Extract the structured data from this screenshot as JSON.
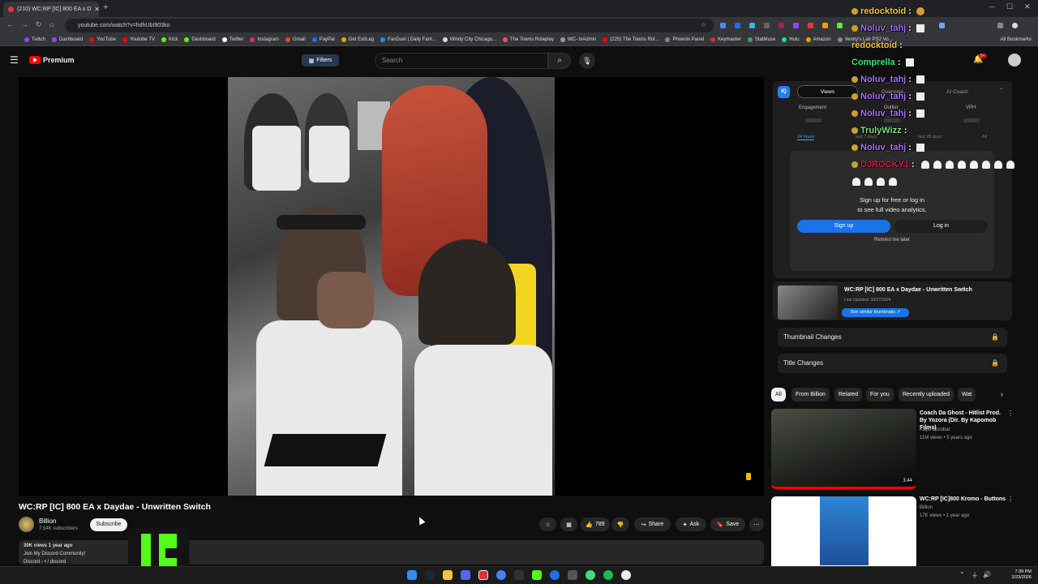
{
  "browser": {
    "tab_title": "(210) WC:RP [IC] 800 EA x D",
    "url": "youtube.com/watch?v=hdhUbI903ko",
    "bookmarks": [
      {
        "label": "Twitch",
        "color": "#9146ff"
      },
      {
        "label": "Dashboard",
        "color": "#9146ff"
      },
      {
        "label": "YouTube",
        "color": "#ff0000"
      },
      {
        "label": "Youtube TV",
        "color": "#ff0000"
      },
      {
        "label": "Kick",
        "color": "#53fc18"
      },
      {
        "label": "Dashboard",
        "color": "#53fc18"
      },
      {
        "label": "Twitter",
        "color": "#ffffff"
      },
      {
        "label": "Instagram",
        "color": "#e1306c"
      },
      {
        "label": "Gmail",
        "color": "#ea4335"
      },
      {
        "label": "PayPal",
        "color": "#1a73e8"
      },
      {
        "label": "Get ExitLag",
        "color": "#f4a000"
      },
      {
        "label": "FanDuel | Daily Fant...",
        "color": "#1493ff"
      },
      {
        "label": "Windy City Chicago...",
        "color": "#dddddd"
      },
      {
        "label": "The Towns Roleplay",
        "color": "#e55"
      },
      {
        "label": "WC- txAdmin",
        "color": "#999"
      },
      {
        "label": "(225) The Towns Rol...",
        "color": "#ff0000"
      },
      {
        "label": "Phoenix Panel",
        "color": "#888"
      },
      {
        "label": "Keymaster",
        "color": "#c33"
      },
      {
        "label": "StatMuse",
        "color": "#3a6"
      },
      {
        "label": "Hulu",
        "color": "#1ce783"
      },
      {
        "label": "Amazon",
        "color": "#ff9900"
      },
      {
        "label": "Venny's Lair PS2 Vo...",
        "color": "#888"
      }
    ],
    "all_bookmarks": "All Bookmarks"
  },
  "youtube": {
    "brand": "Premium",
    "filters": "Filters",
    "search_placeholder": "Search",
    "create": "Create",
    "notif_count": "9+"
  },
  "video": {
    "title": "WC:RP [IC] 800 EA x Daydae - Unwritten Switch",
    "channel": "Billion",
    "subscribers": "7.54K subscribers",
    "subscribe": "Subscribe",
    "likes": "789",
    "share": "Share",
    "ask": "Ask",
    "save": "Save",
    "views_date": "30K views  1 year ago",
    "desc_line1": "Join My Discord Community!",
    "desc_line2": "Discord - • / discord"
  },
  "vidiq": {
    "tabs": [
      "Views",
      "Overview",
      "AI Coach"
    ],
    "stats": [
      "Engagement",
      "Outlier",
      "VPH"
    ],
    "periods": [
      "24 hours",
      "last 7 days",
      "last 28 days",
      "All"
    ],
    "signup_line1": "Sign up for free or log in",
    "signup_line2": "to see full video analytics.",
    "signup_btn": "Sign up",
    "login_btn": "Log in",
    "remind": "Remind me later",
    "video_title": "WC:RP [IC] 800 EA x Daydae - Unwritten Switch",
    "last_updated": "Last Updated: 10/27/2024",
    "similar": "See similar thumbnails ↗",
    "thumbnail_changes": "Thumbnail Changes",
    "title_changes": "Title Changes"
  },
  "chips": [
    "All",
    "From Billion",
    "Related",
    "For you",
    "Recently uploaded",
    "Wat"
  ],
  "recommendations": [
    {
      "title": "Coach Da Ghost - Hitlist Prod. By Yozora (Dir. By Kapomob Films)",
      "channel": "Kapo Escobar",
      "meta": "11M views • 5 years ago",
      "duration": "3:44"
    },
    {
      "title": "WC:RP [IC]800 Kromo - Buttons",
      "channel": "Billion",
      "meta": "17K views • 1 year ago",
      "duration": ""
    }
  ],
  "chat": [
    {
      "user": "redocktoid",
      "color": "#f7c948",
      "emote": "croissant"
    },
    {
      "user": "Noluv_tahj",
      "color": "#a970ff",
      "emote": "square"
    },
    {
      "user": "redocktoid",
      "color": "#f7c948",
      "emote": ""
    },
    {
      "user": "Comprella",
      "color": "#3ee07a",
      "emote": "square"
    },
    {
      "user": "Noluv_tahj",
      "color": "#a970ff",
      "emote": "square"
    },
    {
      "user": "Noluv_tahj",
      "color": "#a970ff",
      "emote": "square"
    },
    {
      "user": "Noluv_tahj",
      "color": "#a970ff",
      "emote": "square"
    },
    {
      "user": "TrulyWizz",
      "color": "#7fe07f",
      "emote": ""
    },
    {
      "user": "Noluv_tahj",
      "color": "#a970ff",
      "emote": "square"
    },
    {
      "user": "DJROCKY1",
      "color": "#e01a4f",
      "emote": "ghosts"
    }
  ],
  "clock": {
    "time": "7:39 PM",
    "date": "2/23/2026"
  }
}
